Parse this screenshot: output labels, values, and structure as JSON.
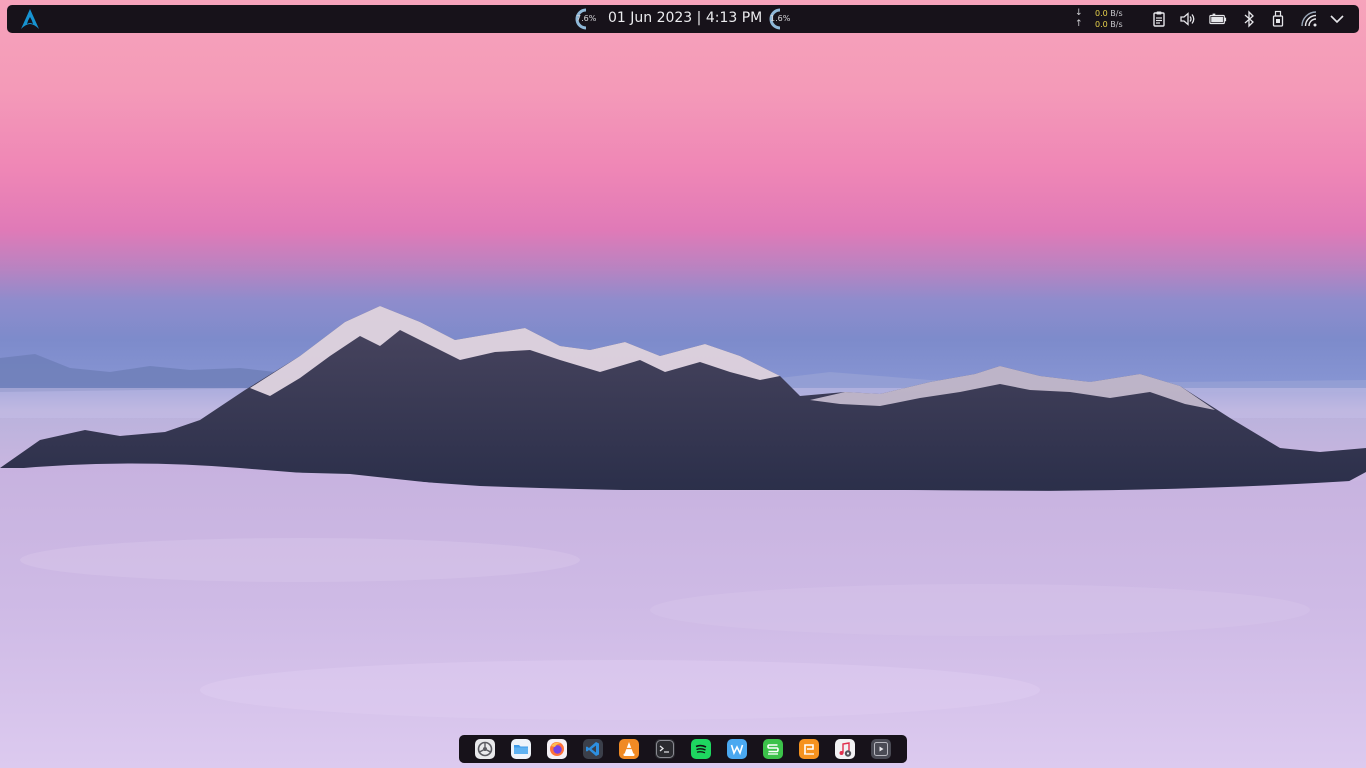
{
  "topbar": {
    "cpu_gauge": {
      "text": "7.6%",
      "value": 7.6
    },
    "datetime": "01 Jun 2023 | 4:13 PM",
    "mem_gauge": {
      "text": "1.6%",
      "value": 1.6
    },
    "network": {
      "down_arrow": "↓",
      "up_arrow": "↑",
      "down_value": "0.0",
      "down_unit": "B/s",
      "up_value": "0.0",
      "up_unit": "B/s"
    },
    "tray_icons": [
      "clipboard-icon",
      "volume-icon",
      "battery-icon",
      "bluetooth-icon",
      "usb-drive-icon",
      "wifi-icon",
      "chevron-down-icon"
    ]
  },
  "dock": {
    "apps": [
      "settings",
      "file-manager",
      "firefox",
      "vscode",
      "vlc",
      "terminal",
      "spotify",
      "wps-writer",
      "wps-spreadsheets",
      "wps-presentation",
      "music-player",
      "video-player"
    ]
  },
  "colors": {
    "bar_background": "#17121a",
    "arch_blue": "#1793d1",
    "net_value_yellow": "#e8d24a",
    "gauge_accent": "#8fb8d8"
  }
}
